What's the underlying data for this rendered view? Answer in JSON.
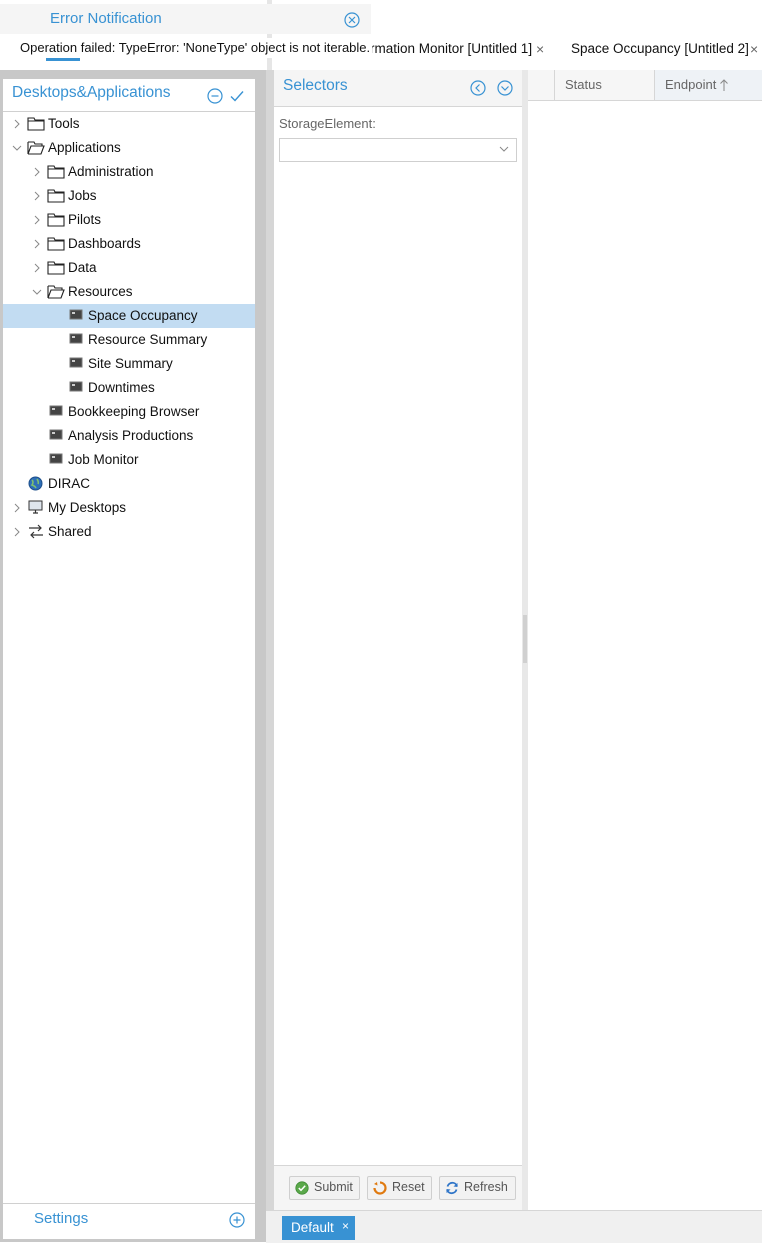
{
  "notification": {
    "title": "Error Notification",
    "message": "Operation failed: TypeError: 'NoneType' object is not iterable."
  },
  "tabs": [
    {
      "label": "rmation Monitor [Untitled 1]",
      "close": "×"
    },
    {
      "label": "Space Occupancy [Untitled 2]",
      "close": "×"
    }
  ],
  "left_panel": {
    "title": "Desktops&Applications",
    "footer_label": "Settings",
    "tree": [
      {
        "label": "Tools"
      },
      {
        "label": "Applications"
      },
      {
        "label": "Administration"
      },
      {
        "label": "Jobs"
      },
      {
        "label": "Pilots"
      },
      {
        "label": "Dashboards"
      },
      {
        "label": "Data"
      },
      {
        "label": "Resources"
      },
      {
        "label": "Space Occupancy"
      },
      {
        "label": "Resource Summary"
      },
      {
        "label": "Site Summary"
      },
      {
        "label": "Downtimes"
      },
      {
        "label": "Bookkeeping Browser"
      },
      {
        "label": "Analysis Productions"
      },
      {
        "label": "Job Monitor"
      },
      {
        "label": "DIRAC"
      },
      {
        "label": "My Desktops"
      },
      {
        "label": "Shared"
      }
    ]
  },
  "selectors": {
    "title": "Selectors",
    "storage_label": "StorageElement:",
    "storage_value": "",
    "buttons": {
      "submit": "Submit",
      "reset": "Reset",
      "refresh": "Refresh"
    }
  },
  "grid": {
    "columns": {
      "status": "Status",
      "endpoint": "Endpoint"
    }
  },
  "taskbar": {
    "default_label": "Default",
    "close": "×"
  },
  "colors": {
    "accent": "#3892d3",
    "selection": "#c2dcf2"
  }
}
